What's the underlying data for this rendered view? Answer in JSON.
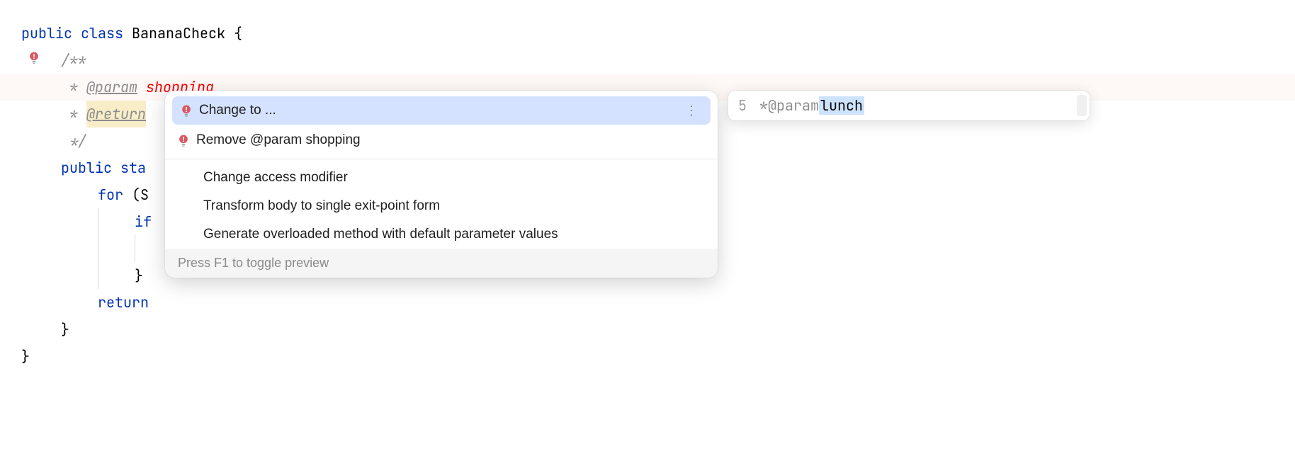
{
  "code": {
    "line1": {
      "public": "public",
      "class": "class",
      "name": "BananaCheck",
      "brace": " {"
    },
    "line2": {
      "comment_open": "/**"
    },
    "line3": {
      "star": " * ",
      "tag": "@param",
      "space": " ",
      "param": "shopping"
    },
    "line4": {
      "star": " * ",
      "tag": "@return"
    },
    "line5": {
      "comment_close": " */"
    },
    "line6": {
      "public": "public",
      "static": "sta"
    },
    "line7": {
      "for": "for",
      "paren": " (S"
    },
    "line8": {
      "if": "if"
    },
    "line9": {
      "brace": "}"
    },
    "line10": {
      "return": "return"
    },
    "line11": {
      "brace": "}"
    },
    "line12": {
      "brace": "}"
    }
  },
  "popup": {
    "items": [
      {
        "label": "Change to ...",
        "icon": "bulb-error",
        "selected": true,
        "more": true
      },
      {
        "label": "Remove @param shopping",
        "icon": "bulb-error"
      }
    ],
    "secondary": [
      {
        "label": "Change access modifier"
      },
      {
        "label": "Transform body to single exit-point form"
      },
      {
        "label": "Generate overloaded method with default parameter values"
      }
    ],
    "footer": "Press F1 to toggle preview"
  },
  "preview": {
    "line_number": "5",
    "star": " * ",
    "tag": "@param",
    "space": " ",
    "value": "lunch"
  }
}
